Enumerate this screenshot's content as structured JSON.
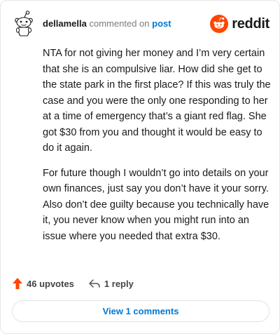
{
  "header": {
    "username": "dellamella",
    "action_text": "commented on",
    "post_link": "post",
    "brand_name": "reddit"
  },
  "comment": {
    "paragraphs": [
      "NTA for not giving her money and I’m very certain that she is an compulsive liar. How did she get to the state park in the first place? If this was truly the case and you were the only one responding to her at a time of emergency that’s a giant red flag. She got $30 from you and thought it would be easy to do it again.",
      "For future though I wouldn’t go into details on your own finances, just say you don’t have it your sorry. Also don’t dee guilty because you technically have it, you never know when you might run into an issue where you needed that extra $30."
    ]
  },
  "actions": {
    "upvotes_label": "46 upvotes",
    "replies_label": "1 reply"
  },
  "footer": {
    "view_comments_label": "View 1 comments"
  },
  "colors": {
    "brand_orange": "#ff4500",
    "link_blue": "#0079d3",
    "upvote_orange": "#ff4500"
  },
  "icons": {
    "avatar": "snoo-avatar-icon",
    "brand": "reddit-logo-icon",
    "upvote": "upvote-arrow-icon",
    "reply": "reply-arrow-icon"
  }
}
